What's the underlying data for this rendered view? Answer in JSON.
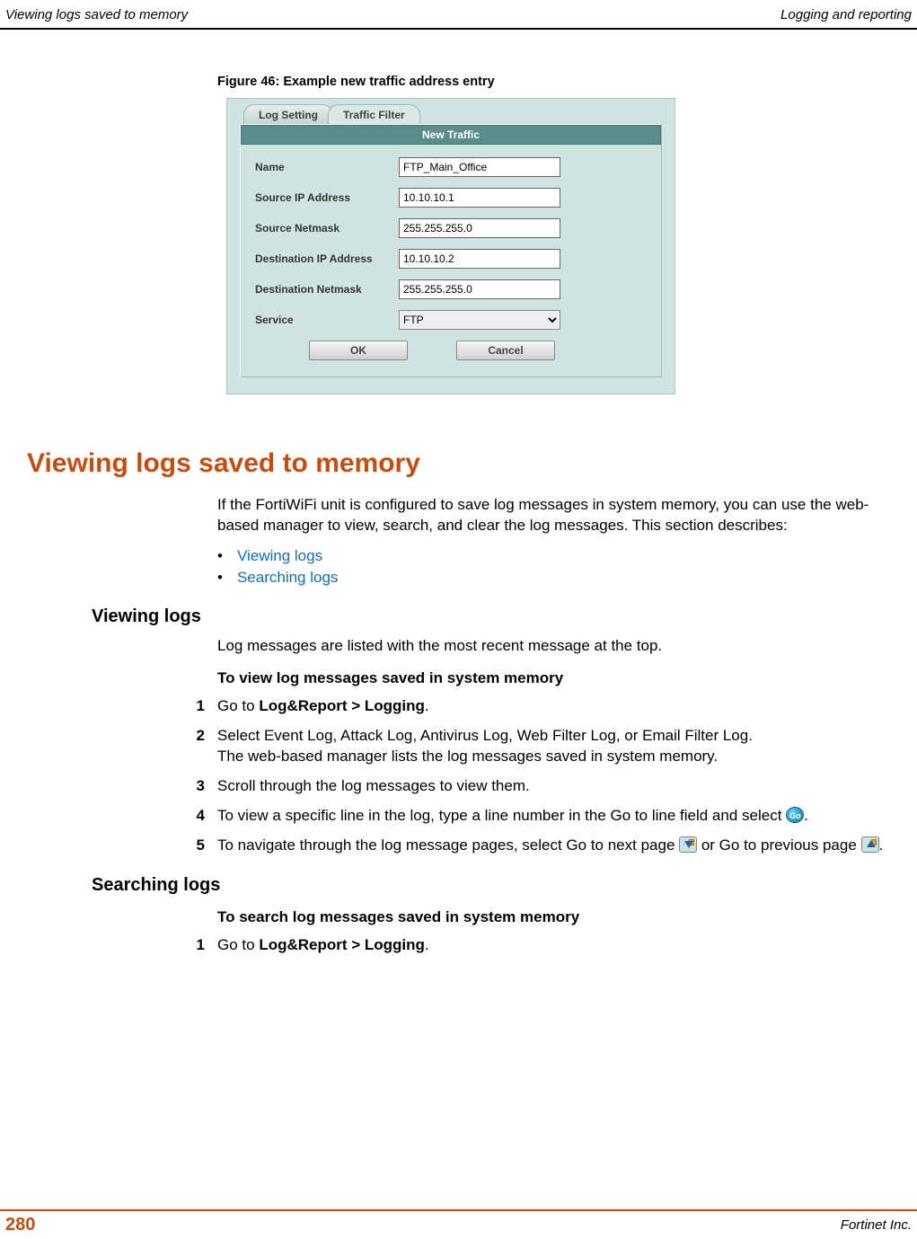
{
  "header": {
    "left": "Viewing logs saved to memory",
    "right": "Logging and reporting"
  },
  "figure": {
    "caption": "Figure 46: Example new traffic address entry",
    "tabs": {
      "inactive": "Log Setting",
      "active": "Traffic Filter"
    },
    "panelTitle": "New Traffic",
    "fields": {
      "name": {
        "label": "Name",
        "value": "FTP_Main_Office"
      },
      "srcip": {
        "label": "Source IP Address",
        "value": "10.10.10.1"
      },
      "srcmask": {
        "label": "Source Netmask",
        "value": "255.255.255.0"
      },
      "dstip": {
        "label": "Destination IP Address",
        "value": "10.10.10.2"
      },
      "dstmask": {
        "label": "Destination Netmask",
        "value": "255.255.255.0"
      },
      "service": {
        "label": "Service",
        "value": "FTP"
      }
    },
    "buttons": {
      "ok": "OK",
      "cancel": "Cancel"
    }
  },
  "section": {
    "title": "Viewing logs saved to memory",
    "intro": "If the FortiWiFi unit is configured to save log messages in system memory, you can use the web-based manager to view, search, and clear the log messages. This section describes:",
    "bullets": [
      "Viewing logs",
      "Searching logs"
    ],
    "sub1": {
      "title": "Viewing logs",
      "p1": "Log messages are listed with the most recent message at the top.",
      "proc": "To view log messages saved in system memory",
      "steps": {
        "s1a": "Go to ",
        "s1b": "Log&Report > Logging",
        "s1c": ".",
        "s2a": "Select Event Log, Attack Log, Antivirus Log, Web Filter Log, or Email Filter Log.",
        "s2b": "The web-based manager lists the log messages saved in system memory.",
        "s3": "Scroll through the log messages to view them.",
        "s4a": "To view a specific line in the log, type a line number in the Go to line field and select ",
        "s4b": ".",
        "s5a": "To navigate through the log message pages, select Go to next page ",
        "s5b": " or Go to previous page ",
        "s5c": "."
      }
    },
    "sub2": {
      "title": "Searching logs",
      "proc": "To search log messages saved in system memory",
      "steps": {
        "s1a": "Go to ",
        "s1b": "Log&Report > Logging",
        "s1c": "."
      }
    }
  },
  "footer": {
    "page": "280",
    "right": "Fortinet Inc."
  }
}
